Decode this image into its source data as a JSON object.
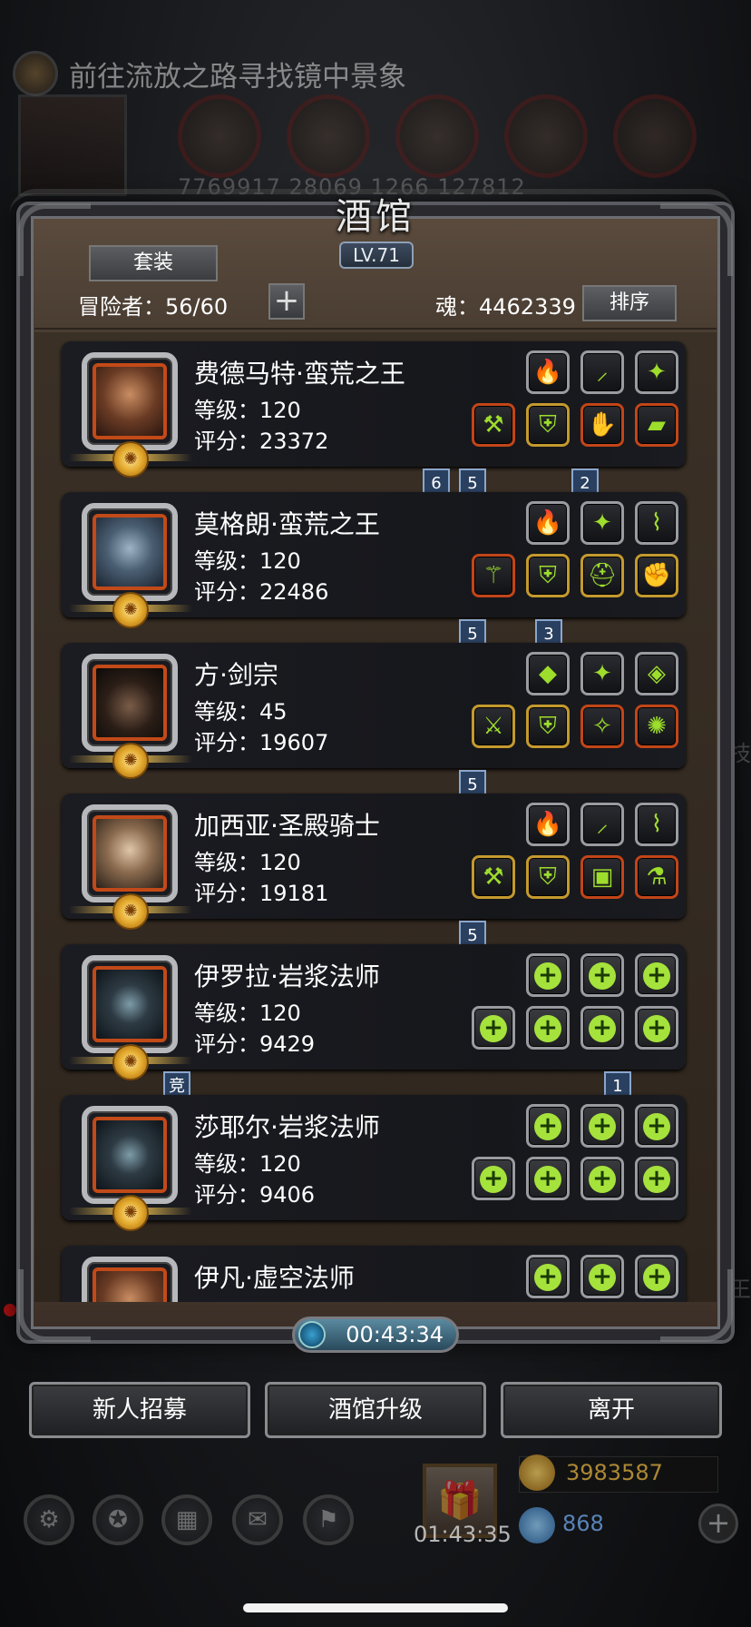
{
  "background": {
    "quest_text": "前往流放之路寻找镜中景象",
    "resource_numbers": "7769917  28069  1266  127812",
    "side_labels": [
      "王",
      "技"
    ]
  },
  "header": {
    "title": "酒馆",
    "level": "LV.71",
    "set_button": "套装",
    "adventurers_label": "冒险者：56/60",
    "plus_button": "+",
    "soul_label": "魂：4462339",
    "sort_button": "排序"
  },
  "heroes": [
    {
      "name": "费德马特·蛮荒之王",
      "level": "等级：120",
      "score": "评分：23372",
      "avatar": "barbarian-portrait",
      "top_slots": [
        {
          "icon": "flame-icon",
          "glyph": "🔥",
          "frame": "plain"
        },
        {
          "icon": "feather-icon",
          "glyph": "⸝",
          "frame": "plain"
        },
        {
          "icon": "crest-icon",
          "glyph": "✦",
          "frame": "plain"
        }
      ],
      "bottom_slots": [
        {
          "icon": "axe-icon",
          "glyph": "⚒",
          "frame": "red"
        },
        {
          "icon": "armor-icon",
          "glyph": "⛨",
          "frame": "gold"
        },
        {
          "icon": "gauntlet-icon",
          "glyph": "✋",
          "frame": "red"
        },
        {
          "icon": "boots-icon",
          "glyph": "▰",
          "frame": "red"
        }
      ],
      "tags": [
        "6",
        "5",
        "2"
      ]
    },
    {
      "name": "莫格朗·蛮荒之王",
      "level": "等级：120",
      "score": "评分：22486",
      "avatar": "demon-portrait",
      "top_slots": [
        {
          "icon": "flame-icon",
          "glyph": "🔥",
          "frame": "plain"
        },
        {
          "icon": "crest-icon",
          "glyph": "✦",
          "frame": "plain"
        },
        {
          "icon": "bracer-icon",
          "glyph": "⌇",
          "frame": "plain"
        }
      ],
      "bottom_slots": [
        {
          "icon": "staff-icon",
          "glyph": "⚚",
          "frame": "red"
        },
        {
          "icon": "armor-icon",
          "glyph": "⛨",
          "frame": "gold"
        },
        {
          "icon": "helmet-icon",
          "glyph": "⛑",
          "frame": "gold"
        },
        {
          "icon": "gauntlet-icon",
          "glyph": "✊",
          "frame": "gold"
        }
      ],
      "tags": [
        "5",
        "3"
      ]
    },
    {
      "name": "方·剑宗",
      "level": "等级：45",
      "score": "评分：19607",
      "avatar": "ranger-portrait",
      "top_slots": [
        {
          "icon": "stone-icon",
          "glyph": "◆",
          "frame": "plain"
        },
        {
          "icon": "crest-icon",
          "glyph": "✦",
          "frame": "plain"
        },
        {
          "icon": "gem-icon",
          "glyph": "◈",
          "frame": "plain"
        }
      ],
      "bottom_slots": [
        {
          "icon": "dragon-sword-icon",
          "glyph": "⚔",
          "frame": "gold"
        },
        {
          "icon": "armor-icon",
          "glyph": "⛨",
          "frame": "gold"
        },
        {
          "icon": "amulet-icon",
          "glyph": "✧",
          "frame": "red"
        },
        {
          "icon": "orb-icon",
          "glyph": "✺",
          "frame": "red"
        }
      ],
      "tags": [
        "5"
      ]
    },
    {
      "name": "加西亚·圣殿骑士",
      "level": "等级：120",
      "score": "评分：19181",
      "avatar": "knight-portrait",
      "top_slots": [
        {
          "icon": "flame-icon",
          "glyph": "🔥",
          "frame": "plain"
        },
        {
          "icon": "feather-icon",
          "glyph": "⸝",
          "frame": "plain"
        },
        {
          "icon": "bracer-icon",
          "glyph": "⌇",
          "frame": "plain"
        }
      ],
      "bottom_slots": [
        {
          "icon": "hammer-icon",
          "glyph": "⚒",
          "frame": "gold"
        },
        {
          "icon": "armor-icon",
          "glyph": "⛨",
          "frame": "gold"
        },
        {
          "icon": "chest-icon",
          "glyph": "▣",
          "frame": "red"
        },
        {
          "icon": "potion-icon",
          "glyph": "⚗",
          "frame": "red"
        }
      ],
      "tags": [
        "5"
      ]
    },
    {
      "name": "伊罗拉·岩浆法师",
      "level": "等级：120",
      "score": "评分：9429",
      "avatar": "hooded-portrait",
      "top_slots": [
        {
          "icon": "add-icon",
          "glyph": "+",
          "frame": "empty"
        },
        {
          "icon": "add-icon",
          "glyph": "+",
          "frame": "empty"
        },
        {
          "icon": "add-icon",
          "glyph": "+",
          "frame": "empty"
        }
      ],
      "bottom_slots": [
        {
          "icon": "add-icon",
          "glyph": "+",
          "frame": "empty"
        },
        {
          "icon": "add-icon",
          "glyph": "+",
          "frame": "empty"
        },
        {
          "icon": "add-icon",
          "glyph": "+",
          "frame": "empty"
        },
        {
          "icon": "add-icon",
          "glyph": "+",
          "frame": "empty"
        }
      ],
      "tags": [
        "竞",
        "1"
      ]
    },
    {
      "name": "莎耶尔·岩浆法师",
      "level": "等级：120",
      "score": "评分：9406",
      "avatar": "hooded-portrait",
      "top_slots": [
        {
          "icon": "add-icon",
          "glyph": "+",
          "frame": "empty"
        },
        {
          "icon": "add-icon",
          "glyph": "+",
          "frame": "empty"
        },
        {
          "icon": "add-icon",
          "glyph": "+",
          "frame": "empty"
        }
      ],
      "bottom_slots": [
        {
          "icon": "add-icon",
          "glyph": "+",
          "frame": "empty"
        },
        {
          "icon": "add-icon",
          "glyph": "+",
          "frame": "empty"
        },
        {
          "icon": "add-icon",
          "glyph": "+",
          "frame": "empty"
        },
        {
          "icon": "add-icon",
          "glyph": "+",
          "frame": "empty"
        }
      ],
      "tags": []
    },
    {
      "name": "伊凡·虚空法师",
      "level": "",
      "score": "",
      "avatar": "barbarian-portrait",
      "top_slots": [
        {
          "icon": "add-icon",
          "glyph": "+",
          "frame": "empty"
        },
        {
          "icon": "add-icon",
          "glyph": "+",
          "frame": "empty"
        },
        {
          "icon": "add-icon",
          "glyph": "+",
          "frame": "empty"
        }
      ],
      "bottom_slots": [],
      "tags": []
    }
  ],
  "timer": "00:43:34",
  "buttons": {
    "recruit": "新人招募",
    "upgrade": "酒馆升级",
    "leave": "离开"
  },
  "hud": {
    "gift_timer": "01:43:35",
    "gold": "3983587",
    "gems": "868",
    "plus": "+"
  },
  "colors": {
    "accent_green": "#9ddd2c",
    "tag_blue": "#2a4060",
    "frame_gold": "#c49a2e",
    "frame_red": "#c24518"
  }
}
